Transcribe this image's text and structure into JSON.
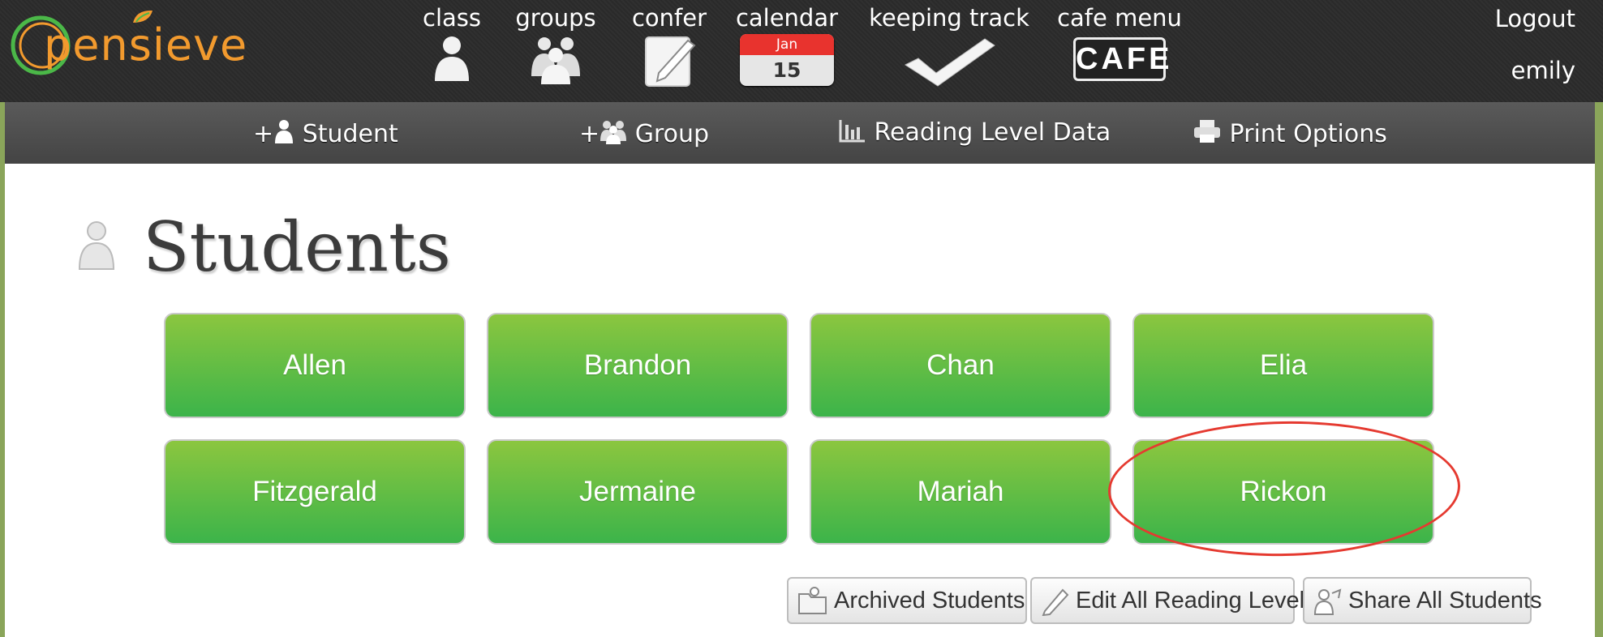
{
  "header": {
    "logo_text": "pensieve",
    "nav": [
      {
        "label": "class",
        "icon": "person-icon"
      },
      {
        "label": "groups",
        "icon": "group-icon"
      },
      {
        "label": "confer",
        "icon": "notepad-pencil-icon"
      },
      {
        "label": "calendar",
        "icon": "calendar-icon"
      },
      {
        "label": "keeping track",
        "icon": "checkmark-icon"
      },
      {
        "label": "cafe menu",
        "icon": "cafe-sign-icon"
      }
    ],
    "calendar_month": "Jan",
    "calendar_day": "15",
    "cafe_text": "CAFE",
    "logout_label": "Logout",
    "username": "emily"
  },
  "toolbar": {
    "add_student": "Student",
    "add_group": "Group",
    "reading_level_data": "Reading Level Data",
    "print_options": "Print Options",
    "plus": "+"
  },
  "main": {
    "title": "Students",
    "students": [
      "Allen",
      "Brandon",
      "Chan",
      "Elia",
      "Fitzgerald",
      "Jermaine",
      "Mariah",
      "Rickon"
    ],
    "actions": {
      "archived": "Archived Students",
      "edit_levels": "Edit All Reading Levels",
      "share": "Share All Students"
    }
  },
  "colors": {
    "student_button_top": "#8bc63f",
    "student_button_bottom": "#3cb44a",
    "highlight_ring": "#e53a30",
    "logo_orange": "#f29a2e",
    "logo_green": "#4bb848"
  }
}
